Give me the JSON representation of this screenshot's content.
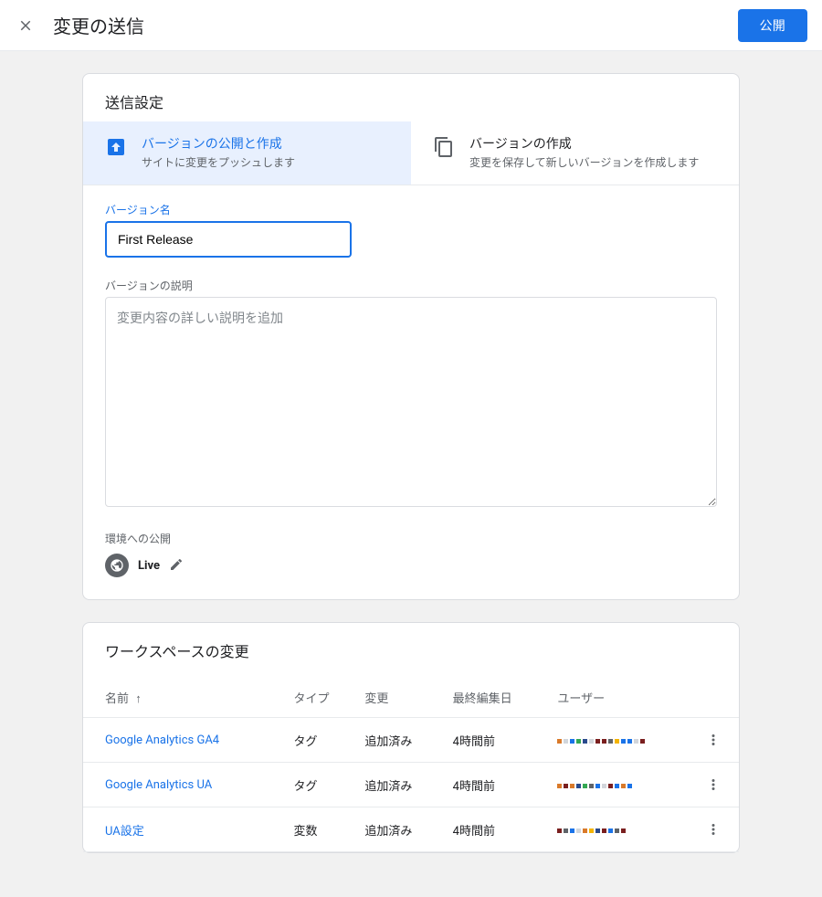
{
  "header": {
    "title": "変更の送信",
    "publish_label": "公開"
  },
  "submission": {
    "section_title": "送信設定",
    "options": [
      {
        "title": "バージョンの公開と作成",
        "desc": "サイトに変更をプッシュします",
        "selected": true
      },
      {
        "title": "バージョンの作成",
        "desc": "変更を保存して新しいバージョンを作成します",
        "selected": false
      }
    ],
    "version_name_label": "バージョン名",
    "version_name_value": "First Release",
    "version_desc_label": "バージョンの説明",
    "version_desc_placeholder": "変更内容の詳しい説明を追加",
    "version_desc_value": "",
    "publish_env_label": "環境への公開",
    "env_name": "Live"
  },
  "workspace_changes": {
    "title": "ワークスペースの変更",
    "columns": {
      "name": "名前",
      "type": "タイプ",
      "change": "変更",
      "last_edited": "最終編集日",
      "user": "ユーザー"
    },
    "sort_ascending": true,
    "rows": [
      {
        "name": "Google Analytics GA4",
        "type": "タグ",
        "change": "追加済み",
        "last_edited": "4時間前",
        "user_colors": [
          "#d97a2a",
          "#d2d6db",
          "#1a73e8",
          "#34a853",
          "#2a4b8d",
          "#d2d6db",
          "#7a1f1f",
          "#7a1f1f",
          "#5f6368",
          "#f4b400",
          "#1a73e8",
          "#1a73e8",
          "#d2d6db",
          "#7a1f1f"
        ]
      },
      {
        "name": "Google Analytics UA",
        "type": "タグ",
        "change": "追加済み",
        "last_edited": "4時間前",
        "user_colors": [
          "#d97a2a",
          "#7a1f1f",
          "#d97a2a",
          "#2a4b8d",
          "#34a853",
          "#5f6368",
          "#1a73e8",
          "#d2d6db",
          "#7a1f1f",
          "#1a73e8",
          "#d97a2a",
          "#1a73e8"
        ]
      },
      {
        "name": "UA設定",
        "type": "変数",
        "change": "追加済み",
        "last_edited": "4時間前",
        "user_colors": [
          "#7a1f1f",
          "#5f6368",
          "#1a73e8",
          "#d2d6db",
          "#d97a2a",
          "#f4b400",
          "#2a4b8d",
          "#7a1f1f",
          "#1a73e8",
          "#5f6368",
          "#7a1f1f"
        ]
      }
    ]
  }
}
